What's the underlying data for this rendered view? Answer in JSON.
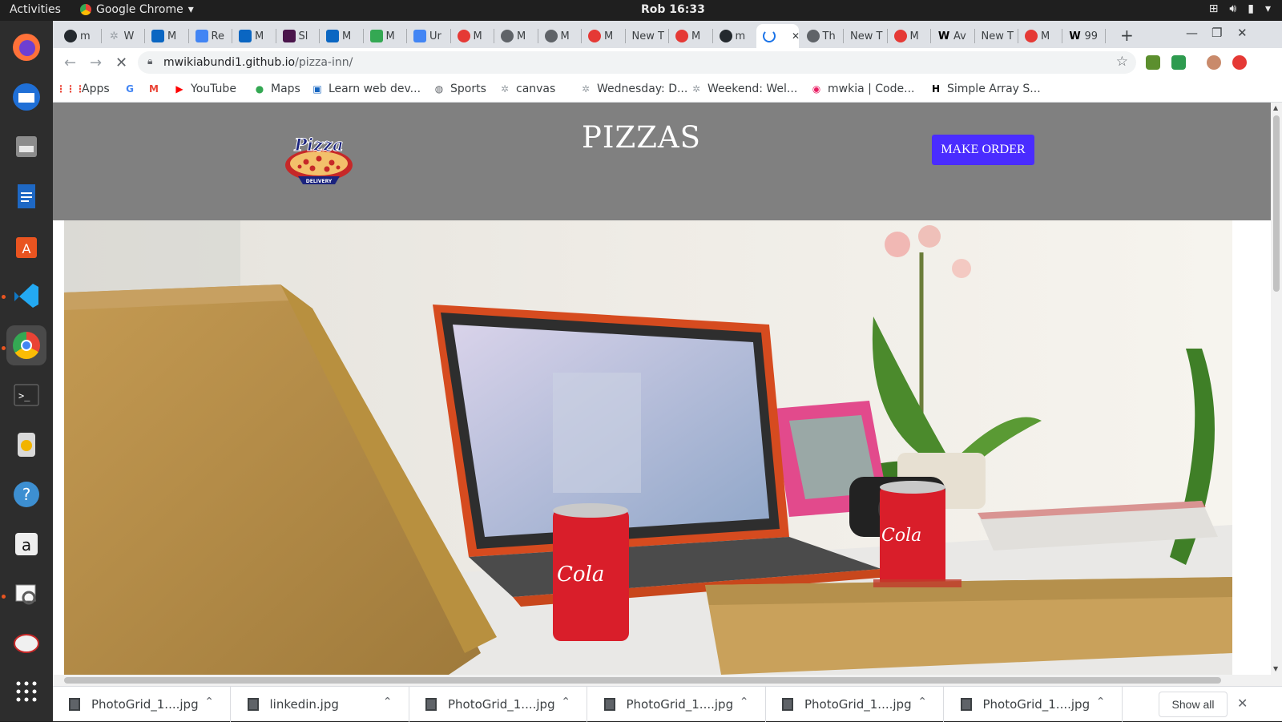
{
  "system": {
    "activities": "Activities",
    "app_name": "Google Chrome",
    "clock": "Rob 16:33"
  },
  "tabs": [
    {
      "label": "m",
      "icon": "github-icon",
      "color": "#24292e"
    },
    {
      "label": "W",
      "icon": "palm-icon",
      "color": "#9aa0a6"
    },
    {
      "label": "M",
      "icon": "linkedin-icon",
      "color": "#0a66c2"
    },
    {
      "label": "Re",
      "icon": "docs-icon",
      "color": "#4285f4"
    },
    {
      "label": "M",
      "icon": "linkedin-icon",
      "color": "#0a66c2"
    },
    {
      "label": "Sl",
      "icon": "slack-icon",
      "color": "#4a154b"
    },
    {
      "label": "M",
      "icon": "linkedin-icon",
      "color": "#0a66c2"
    },
    {
      "label": "M",
      "icon": "drive-icon",
      "color": "#34a853"
    },
    {
      "label": "Ur",
      "icon": "docs-icon",
      "color": "#4285f4"
    },
    {
      "label": "M",
      "icon": "mw-icon",
      "color": "#e53935"
    },
    {
      "label": "M",
      "icon": "globe-icon",
      "color": "#5f6368"
    },
    {
      "label": "M",
      "icon": "globe-icon",
      "color": "#5f6368"
    },
    {
      "label": "M",
      "icon": "mw-icon",
      "color": "#e53935"
    },
    {
      "label": "New T",
      "icon": "",
      "color": ""
    },
    {
      "label": "M",
      "icon": "mw-icon",
      "color": "#e53935"
    },
    {
      "label": "m",
      "icon": "github-icon",
      "color": "#24292e"
    },
    {
      "label": "",
      "icon": "loading-icon",
      "color": "#1a73e8",
      "active": true
    },
    {
      "label": "Th",
      "icon": "globe-icon",
      "color": "#5f6368"
    },
    {
      "label": "New T",
      "icon": "",
      "color": ""
    },
    {
      "label": "M",
      "icon": "mw-icon",
      "color": "#e53935"
    },
    {
      "label": "Av",
      "icon": "w-icon",
      "color": "#000000"
    },
    {
      "label": "New T",
      "icon": "",
      "color": ""
    },
    {
      "label": "M",
      "icon": "mw-icon",
      "color": "#e53935"
    },
    {
      "label": "99",
      "icon": "w-icon",
      "color": "#000000"
    }
  ],
  "address_bar": {
    "host": "mwikiabundi1.github.io",
    "path": "/pizza-inn/"
  },
  "bookmarks": [
    {
      "label": "Apps",
      "icon": "apps-grid-icon",
      "glyph": "⋮⋮⋮",
      "color": "#ea4335"
    },
    {
      "label": "",
      "icon": "google-icon",
      "glyph": "G",
      "color": "#4285f4"
    },
    {
      "label": "",
      "icon": "gmail-icon",
      "glyph": "M",
      "color": "#ea4335"
    },
    {
      "label": "YouTube",
      "icon": "youtube-icon",
      "glyph": "▶",
      "color": "#ff0000"
    },
    {
      "label": "Maps",
      "icon": "maps-pin-icon",
      "glyph": "●",
      "color": "#34a853"
    },
    {
      "label": "Learn web dev...",
      "icon": "learn-icon",
      "glyph": "▣",
      "color": "#1565c0"
    },
    {
      "label": "Sports",
      "icon": "globe-icon",
      "glyph": "◍",
      "color": "#5f6368"
    },
    {
      "label": "canvas",
      "icon": "palm-icon",
      "glyph": "✲",
      "color": "#9aa0a6"
    },
    {
      "label": "Wednesday: D...",
      "icon": "palm-icon",
      "glyph": "✲",
      "color": "#9aa0a6"
    },
    {
      "label": "Weekend: Wel...",
      "icon": "palm-icon",
      "glyph": "✲",
      "color": "#9aa0a6"
    },
    {
      "label": "mwkia | Code...",
      "icon": "codewars-icon",
      "glyph": "◉",
      "color": "#e91e63"
    },
    {
      "label": "Simple Array S...",
      "icon": "hackerrank-icon",
      "glyph": "H",
      "color": "#000000"
    }
  ],
  "page": {
    "title": "PIZZAS",
    "order_button": "MAKE ORDER",
    "logo_text": "Pizza",
    "logo_subtext": "DELIVERY",
    "header_bg": "#808080",
    "accent": "#4a2cff"
  },
  "downloads": [
    {
      "name": "PhotoGrid_1....jpg"
    },
    {
      "name": "linkedin.jpg"
    },
    {
      "name": "PhotoGrid_1....jpg"
    },
    {
      "name": "PhotoGrid_1....jpg"
    },
    {
      "name": "PhotoGrid_1....jpg"
    },
    {
      "name": "PhotoGrid_1....jpg"
    }
  ],
  "download_shelf": {
    "show_all": "Show all"
  }
}
